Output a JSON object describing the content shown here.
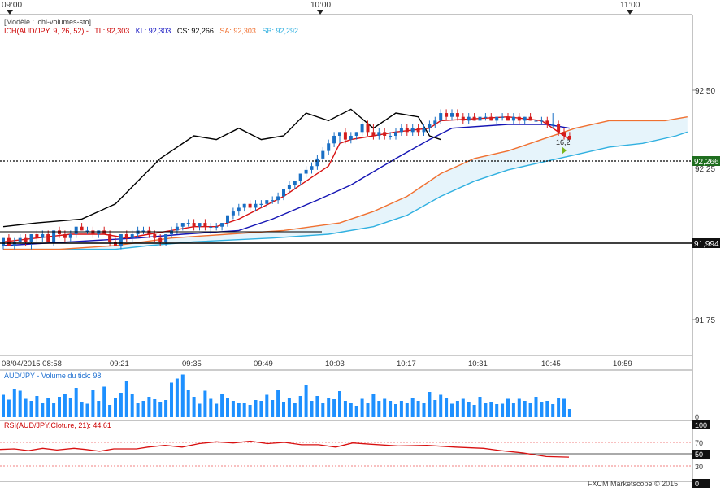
{
  "top_axis": {
    "labels": [
      "09:00",
      "10:00",
      "11:00"
    ]
  },
  "header": {
    "model": "[Modèle : ichi-volumes-sto]",
    "parts": [
      {
        "text": "ICH(AUD/JPY, 9, 26, 52) -",
        "color": "#cc0000"
      },
      {
        "text": "TL: 92,303",
        "color": "#cc0000"
      },
      {
        "text": "KL: 92,303",
        "color": "#1010c0"
      },
      {
        "text": "CS: 92,266",
        "color": "#000000"
      },
      {
        "text": "SA: 92,303",
        "color": "#f07030"
      },
      {
        "text": "SB: 92,292",
        "color": "#30b0e0"
      }
    ]
  },
  "price_axis": {
    "ticks": [
      "92,50",
      "92,25",
      "91,75"
    ],
    "current_label": "92,266",
    "level_label": "91,994"
  },
  "x_axis": {
    "labels": [
      "08/04/2015 08:58",
      "09:21",
      "09:35",
      "09:49",
      "10:03",
      "10:17",
      "10:31",
      "10:45",
      "10:59"
    ]
  },
  "annotation": "16,2",
  "volume_panel": {
    "title": "AUD/JPY - Volume du tick: 98",
    "axis_label": "0"
  },
  "rsi_panel": {
    "title": "RSI(AUD/JPY,Cloture, 21): 44,61",
    "ticks": [
      "100",
      "70",
      "50",
      "30",
      "0"
    ]
  },
  "footer": {
    "credit": "FXCM Marketscope © 2015"
  },
  "colors": {
    "tenkan": "#d81010",
    "kijun": "#1414b4",
    "chikou": "#000000",
    "senkou_a": "#f07030",
    "senkou_b": "#30b0e0",
    "cloud": "#e6f4fb",
    "bull": "#1a6fc4",
    "bear": "#d41c1c",
    "volume": "#1e90ff",
    "rsi": "#d81010"
  },
  "chart_data": {
    "type": "candlestick",
    "instrument": "AUD/JPY",
    "price_ylim": [
      91.7,
      92.6
    ],
    "candles_ohlc": [
      [
        91.99,
        92.01,
        91.98,
        92.01
      ],
      [
        92.01,
        92.02,
        91.99,
        91.99
      ],
      [
        91.99,
        92.01,
        91.98,
        92.0
      ],
      [
        92.0,
        92.02,
        91.99,
        92.01
      ],
      [
        92.01,
        92.02,
        91.99,
        92.0
      ],
      [
        92.0,
        92.02,
        91.98,
        92.02
      ],
      [
        92.02,
        92.03,
        92.0,
        92.01
      ],
      [
        92.01,
        92.03,
        92.0,
        92.02
      ],
      [
        92.02,
        92.03,
        92.0,
        92.0
      ],
      [
        92.0,
        92.03,
        91.99,
        92.03
      ],
      [
        92.03,
        92.04,
        92.01,
        92.02
      ],
      [
        92.02,
        92.03,
        92.0,
        92.01
      ],
      [
        92.01,
        92.03,
        92.0,
        92.02
      ],
      [
        92.02,
        92.04,
        92.01,
        92.04
      ],
      [
        92.04,
        92.05,
        92.03,
        92.03
      ],
      [
        92.03,
        92.04,
        92.02,
        92.03
      ],
      [
        92.03,
        92.04,
        92.01,
        92.02
      ],
      [
        92.02,
        92.03,
        92.01,
        92.03
      ],
      [
        92.03,
        92.04,
        92.02,
        92.02
      ],
      [
        92.02,
        92.03,
        91.99,
        92.0
      ],
      [
        92.0,
        92.01,
        91.99,
        91.99
      ],
      [
        91.99,
        92.02,
        91.98,
        92.02
      ],
      [
        92.02,
        92.03,
        92.0,
        92.01
      ],
      [
        92.01,
        92.03,
        92.0,
        92.02
      ],
      [
        92.02,
        92.04,
        92.01,
        92.03
      ],
      [
        92.03,
        92.04,
        92.02,
        92.03
      ],
      [
        92.03,
        92.04,
        92.01,
        92.02
      ],
      [
        92.02,
        92.03,
        92.0,
        92.01
      ],
      [
        92.01,
        92.02,
        91.99,
        92.0
      ],
      [
        92.0,
        92.02,
        91.99,
        92.02
      ],
      [
        92.02,
        92.04,
        92.01,
        92.03
      ],
      [
        92.03,
        92.05,
        92.02,
        92.04
      ],
      [
        92.04,
        92.05,
        92.03,
        92.05
      ],
      [
        92.05,
        92.06,
        92.04,
        92.05
      ],
      [
        92.05,
        92.06,
        92.03,
        92.04
      ],
      [
        92.04,
        92.05,
        92.03,
        92.05
      ],
      [
        92.05,
        92.06,
        92.03,
        92.04
      ],
      [
        92.04,
        92.05,
        92.02,
        92.04
      ],
      [
        92.04,
        92.05,
        92.03,
        92.04
      ],
      [
        92.04,
        92.05,
        92.03,
        92.05
      ],
      [
        92.05,
        92.07,
        92.04,
        92.07
      ],
      [
        92.07,
        92.09,
        92.06,
        92.08
      ],
      [
        92.08,
        92.1,
        92.07,
        92.09
      ],
      [
        92.09,
        92.1,
        92.08,
        92.1
      ],
      [
        92.1,
        92.11,
        92.08,
        92.09
      ],
      [
        92.09,
        92.11,
        92.08,
        92.1
      ],
      [
        92.1,
        92.11,
        92.09,
        92.1
      ],
      [
        92.1,
        92.11,
        92.09,
        92.11
      ],
      [
        92.11,
        92.12,
        92.1,
        92.11
      ],
      [
        92.11,
        92.13,
        92.1,
        92.12
      ],
      [
        92.12,
        92.14,
        92.11,
        92.14
      ],
      [
        92.14,
        92.16,
        92.13,
        92.15
      ],
      [
        92.15,
        92.16,
        92.14,
        92.16
      ],
      [
        92.16,
        92.18,
        92.15,
        92.18
      ],
      [
        92.18,
        92.2,
        92.17,
        92.19
      ],
      [
        92.19,
        92.21,
        92.18,
        92.2
      ],
      [
        92.2,
        92.23,
        92.19,
        92.22
      ],
      [
        92.22,
        92.25,
        92.21,
        92.24
      ],
      [
        92.24,
        92.27,
        92.23,
        92.26
      ],
      [
        92.26,
        92.29,
        92.25,
        92.28
      ],
      [
        92.28,
        92.29,
        92.26,
        92.29
      ],
      [
        92.29,
        92.3,
        92.26,
        92.27
      ],
      [
        92.27,
        92.29,
        92.26,
        92.28
      ],
      [
        92.28,
        92.29,
        92.27,
        92.29
      ],
      [
        92.29,
        92.32,
        92.28,
        92.31
      ],
      [
        92.31,
        92.32,
        92.28,
        92.29
      ],
      [
        92.29,
        92.31,
        92.27,
        92.28
      ],
      [
        92.28,
        92.3,
        92.27,
        92.29
      ],
      [
        92.29,
        92.3,
        92.27,
        92.28
      ],
      [
        92.28,
        92.29,
        92.27,
        92.28
      ],
      [
        92.28,
        92.3,
        92.27,
        92.29
      ],
      [
        92.29,
        92.31,
        92.28,
        92.3
      ],
      [
        92.3,
        92.31,
        92.28,
        92.29
      ],
      [
        92.29,
        92.31,
        92.28,
        92.3
      ],
      [
        92.3,
        92.31,
        92.28,
        92.29
      ],
      [
        92.29,
        92.31,
        92.28,
        92.3
      ],
      [
        92.3,
        92.32,
        92.29,
        92.31
      ],
      [
        92.31,
        92.33,
        92.3,
        92.32
      ],
      [
        92.32,
        92.35,
        92.31,
        92.34
      ],
      [
        92.34,
        92.35,
        92.32,
        92.33
      ],
      [
        92.33,
        92.35,
        92.32,
        92.34
      ],
      [
        92.34,
        92.35,
        92.32,
        92.33
      ],
      [
        92.33,
        92.34,
        92.31,
        92.32
      ],
      [
        92.32,
        92.34,
        92.31,
        92.33
      ],
      [
        92.33,
        92.34,
        92.32,
        92.32
      ],
      [
        92.32,
        92.34,
        92.31,
        92.33
      ],
      [
        92.33,
        92.34,
        92.32,
        92.33
      ],
      [
        92.33,
        92.34,
        92.32,
        92.32
      ],
      [
        92.32,
        92.33,
        92.31,
        92.33
      ],
      [
        92.33,
        92.34,
        92.32,
        92.33
      ],
      [
        92.33,
        92.34,
        92.32,
        92.32
      ],
      [
        92.32,
        92.34,
        92.31,
        92.33
      ],
      [
        92.33,
        92.34,
        92.31,
        92.32
      ],
      [
        92.32,
        92.33,
        92.31,
        92.33
      ],
      [
        92.33,
        92.34,
        92.32,
        92.32
      ],
      [
        92.32,
        92.33,
        92.31,
        92.32
      ],
      [
        92.32,
        92.33,
        92.31,
        92.32
      ],
      [
        92.32,
        92.33,
        92.3,
        92.31
      ],
      [
        92.31,
        92.34,
        92.3,
        92.31
      ],
      [
        92.31,
        92.32,
        92.28,
        92.29
      ],
      [
        92.29,
        92.3,
        92.27,
        92.28
      ],
      [
        92.28,
        92.29,
        92.27,
        92.27
      ]
    ],
    "tenkan": [
      [
        0,
        92.0
      ],
      [
        6,
        92.01
      ],
      [
        12,
        92.02
      ],
      [
        18,
        92.02
      ],
      [
        22,
        92.01
      ],
      [
        26,
        92.02
      ],
      [
        30,
        92.03
      ],
      [
        34,
        92.04
      ],
      [
        38,
        92.04
      ],
      [
        42,
        92.06
      ],
      [
        46,
        92.09
      ],
      [
        50,
        92.12
      ],
      [
        54,
        92.16
      ],
      [
        58,
        92.2
      ],
      [
        60,
        92.26
      ],
      [
        62,
        92.27
      ],
      [
        66,
        92.28
      ],
      [
        70,
        92.29
      ],
      [
        76,
        92.3
      ],
      [
        78,
        92.32
      ],
      [
        90,
        92.33
      ],
      [
        96,
        92.32
      ],
      [
        100,
        92.28
      ],
      [
        101,
        92.27
      ]
    ],
    "kijun": [
      [
        0,
        91.99
      ],
      [
        12,
        92.0
      ],
      [
        24,
        92.01
      ],
      [
        32,
        92.02
      ],
      [
        42,
        92.03
      ],
      [
        48,
        92.06
      ],
      [
        56,
        92.11
      ],
      [
        62,
        92.15
      ],
      [
        70,
        92.22
      ],
      [
        76,
        92.27
      ],
      [
        80,
        92.3
      ],
      [
        90,
        92.31
      ],
      [
        97,
        92.31
      ],
      [
        101,
        92.3
      ]
    ],
    "chikou": [
      [
        0,
        92.04
      ],
      [
        6,
        92.05
      ],
      [
        14,
        92.06
      ],
      [
        20,
        92.1
      ],
      [
        24,
        92.16
      ],
      [
        28,
        92.22
      ],
      [
        34,
        92.28
      ],
      [
        38,
        92.27
      ],
      [
        42,
        92.3
      ],
      [
        46,
        92.27
      ],
      [
        50,
        92.28
      ],
      [
        54,
        92.34
      ],
      [
        58,
        92.32
      ],
      [
        62,
        92.35
      ],
      [
        66,
        92.3
      ],
      [
        70,
        92.34
      ],
      [
        74,
        92.33
      ],
      [
        76,
        92.28
      ],
      [
        78,
        92.27
      ]
    ],
    "senkou_a": [
      [
        0,
        91.98
      ],
      [
        10,
        91.98
      ],
      [
        20,
        91.99
      ],
      [
        30,
        92.01
      ],
      [
        40,
        92.02
      ],
      [
        50,
        92.03
      ],
      [
        60,
        92.05
      ],
      [
        66,
        92.08
      ],
      [
        72,
        92.12
      ],
      [
        78,
        92.18
      ],
      [
        84,
        92.22
      ],
      [
        90,
        92.24
      ],
      [
        96,
        92.27
      ],
      [
        102,
        92.3
      ],
      [
        108,
        92.32
      ],
      [
        118,
        92.32
      ],
      [
        122,
        92.33
      ]
    ],
    "senkou_b": [
      [
        0,
        91.98
      ],
      [
        20,
        91.98
      ],
      [
        26,
        91.99
      ],
      [
        34,
        92.0
      ],
      [
        48,
        92.01
      ],
      [
        58,
        92.02
      ],
      [
        66,
        92.04
      ],
      [
        72,
        92.07
      ],
      [
        78,
        92.12
      ],
      [
        84,
        92.16
      ],
      [
        90,
        92.19
      ],
      [
        96,
        92.21
      ],
      [
        102,
        92.23
      ],
      [
        108,
        92.25
      ],
      [
        114,
        92.26
      ],
      [
        120,
        92.28
      ],
      [
        122,
        92.29
      ]
    ],
    "current_price": 92.266,
    "level_price": 91.994,
    "volume": [
      55,
      43,
      70,
      65,
      45,
      40,
      52,
      34,
      48,
      35,
      50,
      58,
      48,
      72,
      38,
      33,
      68,
      40,
      75,
      30,
      48,
      60,
      90,
      58,
      35,
      40,
      50,
      44,
      38,
      42,
      85,
      95,
      105,
      68,
      50,
      33,
      65,
      45,
      33,
      58,
      48,
      40,
      34,
      36,
      30,
      42,
      40,
      55,
      42,
      66,
      38,
      48,
      35,
      52,
      78,
      40,
      52,
      34,
      48,
      44,
      64,
      40,
      35,
      28,
      45,
      36,
      58,
      40,
      45,
      40,
      32,
      40,
      35,
      48,
      40,
      34,
      62,
      42,
      55,
      48,
      33,
      40,
      45,
      38,
      30,
      50,
      34,
      38,
      32,
      33,
      45,
      35,
      45,
      40,
      35,
      50,
      38,
      40,
      32,
      48,
      45,
      20
    ],
    "rsi": [
      [
        0,
        58
      ],
      [
        5,
        59
      ],
      [
        10,
        56
      ],
      [
        15,
        60
      ],
      [
        20,
        57
      ],
      [
        26,
        60
      ],
      [
        30,
        58
      ],
      [
        35,
        55
      ],
      [
        40,
        59
      ],
      [
        48,
        59
      ],
      [
        52,
        62
      ],
      [
        58,
        65
      ],
      [
        64,
        62
      ],
      [
        70,
        68
      ],
      [
        76,
        71
      ],
      [
        82,
        69
      ],
      [
        88,
        72
      ],
      [
        94,
        68
      ],
      [
        100,
        70
      ],
      [
        106,
        66
      ],
      [
        112,
        66
      ],
      [
        118,
        62
      ],
      [
        124,
        69
      ],
      [
        130,
        67
      ],
      [
        140,
        64
      ],
      [
        150,
        65
      ],
      [
        160,
        62
      ],
      [
        170,
        60
      ],
      [
        176,
        56
      ],
      [
        184,
        52
      ],
      [
        192,
        46
      ],
      [
        200,
        45
      ]
    ]
  }
}
